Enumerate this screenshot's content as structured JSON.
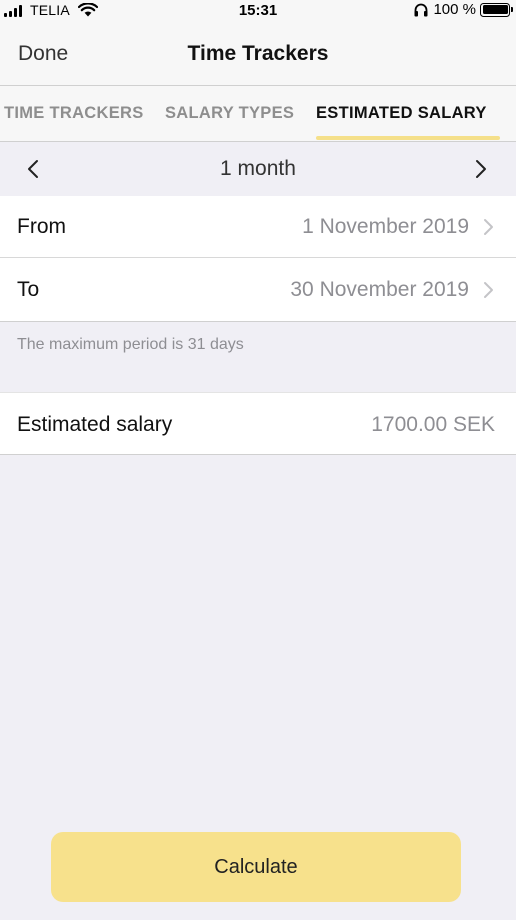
{
  "status_bar": {
    "carrier": "TELIA",
    "time": "15:31",
    "battery": "100 %",
    "icons": [
      "signal-bars-icon",
      "wifi-icon",
      "headphones-icon",
      "battery-icon"
    ]
  },
  "nav": {
    "done_label": "Done",
    "title": "Time Trackers"
  },
  "tabs": [
    {
      "label": "TIME TRACKERS",
      "active": false
    },
    {
      "label": "SALARY TYPES",
      "active": false
    },
    {
      "label": "ESTIMATED SALARY",
      "active": true
    }
  ],
  "period": {
    "label": "1 month",
    "prev_icon": "chevron-left-icon",
    "next_icon": "chevron-right-icon"
  },
  "dates": [
    {
      "label": "From",
      "value": "1 November 2019"
    },
    {
      "label": "To",
      "value": "30 November 2019"
    }
  ],
  "footnote": "The maximum period is 31 days",
  "estimated": {
    "label": "Estimated salary",
    "value": "1700.00 SEK"
  },
  "calculate_label": "Calculate",
  "colors": {
    "accent": "#f7e18c",
    "background": "#f0eff5",
    "bar": "#f7f7f7",
    "secondary_text": "#8e8e93"
  }
}
